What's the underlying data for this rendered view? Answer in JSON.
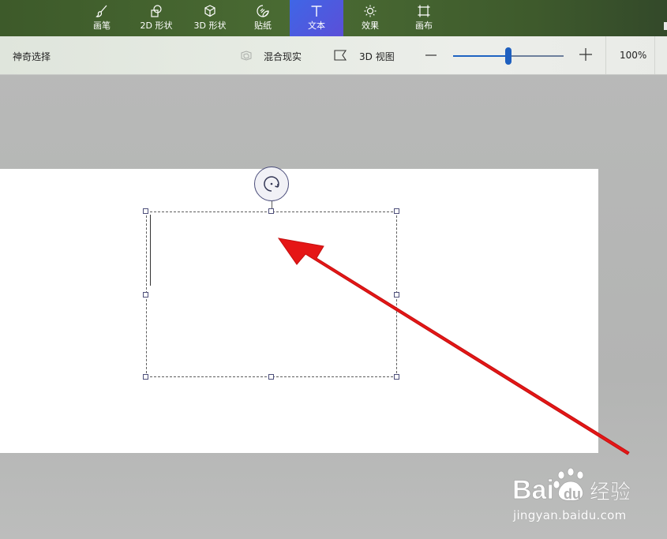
{
  "ribbon": {
    "tabs": [
      {
        "id": "brushes",
        "label": "画笔",
        "icon": "brush-icon"
      },
      {
        "id": "shapes2d",
        "label": "2D 形状",
        "icon": "2d-shapes-icon"
      },
      {
        "id": "shapes3d",
        "label": "3D 形状",
        "icon": "3d-cube-icon"
      },
      {
        "id": "stickers",
        "label": "贴纸",
        "icon": "sticker-icon"
      },
      {
        "id": "text",
        "label": "文本",
        "icon": "text-t-icon",
        "active": true
      },
      {
        "id": "effects",
        "label": "效果",
        "icon": "sun-effects-icon"
      },
      {
        "id": "canvas",
        "label": "画布",
        "icon": "canvas-crop-icon"
      }
    ],
    "active_color": "#4b5ae0"
  },
  "toolbar": {
    "magic_select_label": "神奇选择",
    "mixed_reality_label": "混合现实",
    "view_3d_label": "3D 视图",
    "zoom_value_label": "100%",
    "zoom_level": 0.5
  },
  "annotation": {
    "arrow_color": "#e51616"
  },
  "watermark": {
    "logo_text": "Bai du 经验",
    "url": "jingyan.baidu.com"
  }
}
